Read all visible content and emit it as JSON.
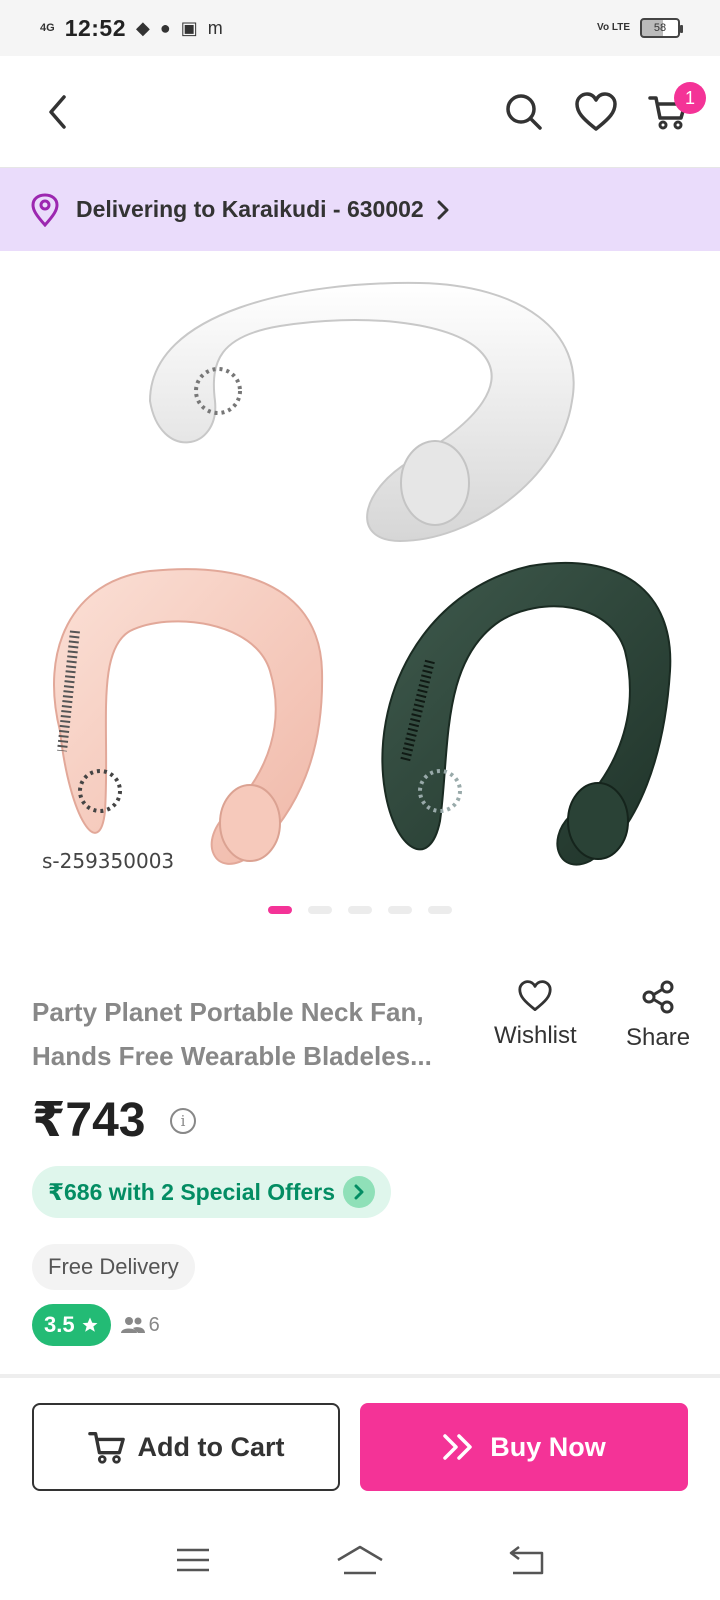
{
  "status_bar": {
    "network": "4G",
    "time": "12:52",
    "volte": "Vo LTE",
    "battery": "58"
  },
  "header": {
    "back_icon": "chevron-left-icon",
    "search_icon": "search-icon",
    "wishlist_icon": "heart-icon",
    "cart_icon": "cart-icon",
    "cart_count": "1"
  },
  "delivery": {
    "text": "Delivering to Karaikudi - 630002"
  },
  "product_image": {
    "code": "s-259350003",
    "active_slide": 1,
    "slides": 5
  },
  "product": {
    "title_line1": "Party Planet Portable Neck Fan,",
    "title_line2": "Hands Free Wearable Bladeles...",
    "price": "₹743",
    "offers": "₹686 with 2 Special Offers",
    "free_delivery": "Free Delivery",
    "rating": "3.5",
    "review_count": "6"
  },
  "actions": {
    "wishlist_label": "Wishlist",
    "share_label": "Share",
    "add_to_cart_label": "Add to Cart",
    "buy_now_label": "Buy Now"
  },
  "colors": {
    "accent": "#f43397",
    "delivery_bg": "#eadcfb",
    "offer_green": "#038d63",
    "rating_green": "#23bb75"
  }
}
